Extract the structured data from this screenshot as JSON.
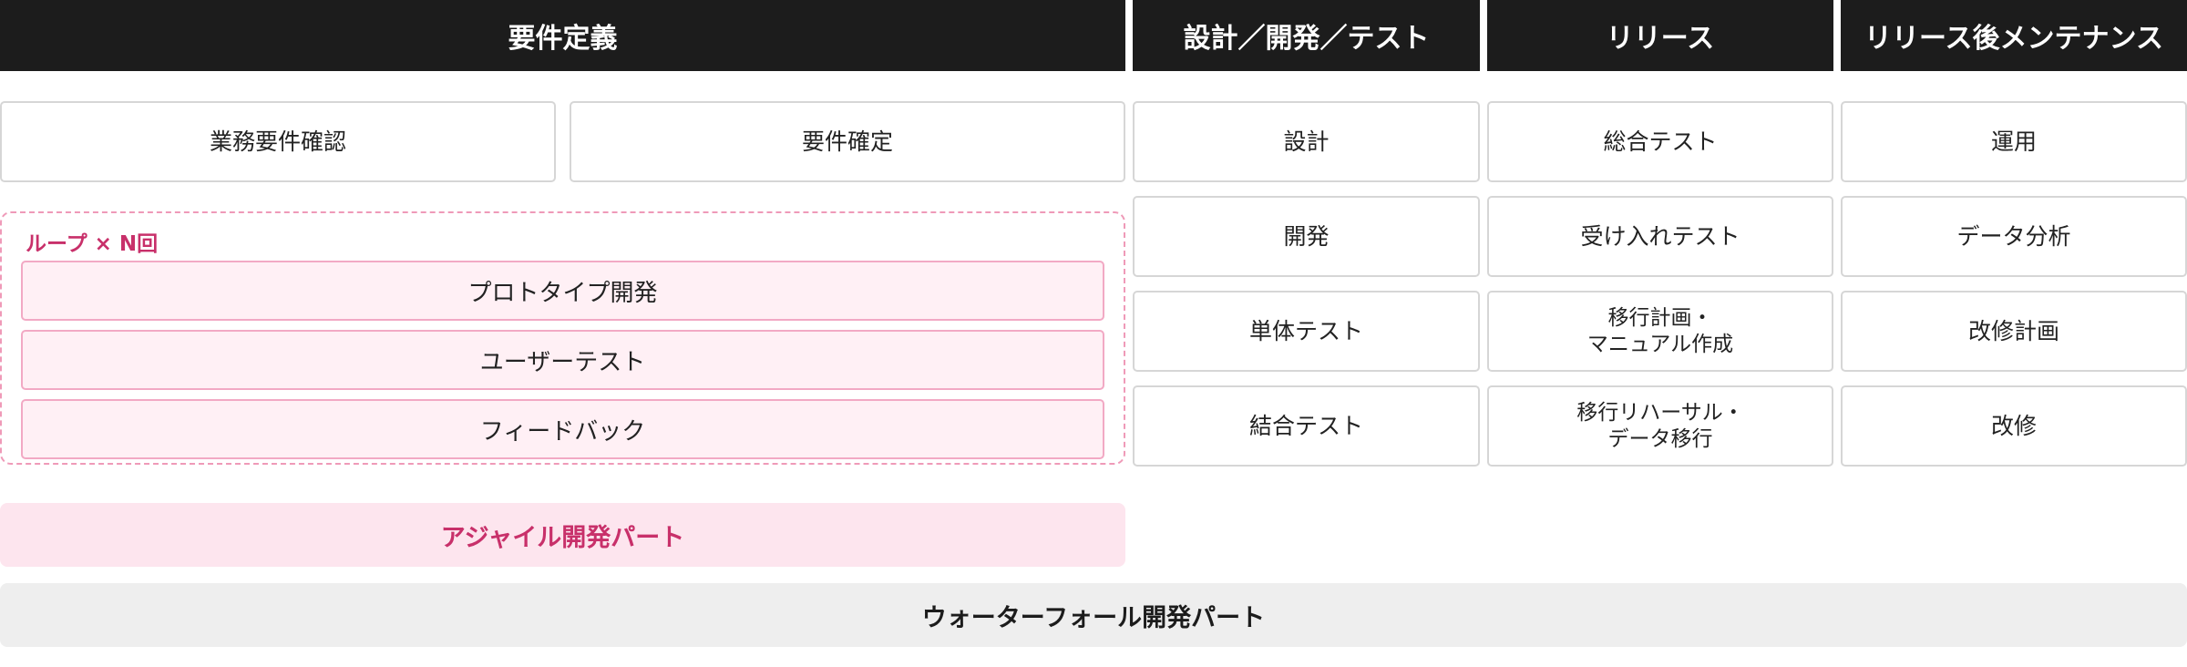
{
  "headers": {
    "requirements": "要件定義",
    "design_dev_test": "設計／開発／テスト",
    "release": "リリース",
    "post_release": "リリース後メンテナンス"
  },
  "requirements_boxes": {
    "business_check": "業務要件確認",
    "finalize": "要件確定"
  },
  "loop": {
    "label": "ループ × N回",
    "steps": [
      "プロトタイプ開発",
      "ユーザーテスト",
      "フィードバック"
    ]
  },
  "design_column": [
    "設計",
    "開発",
    "単体テスト",
    "結合テスト"
  ],
  "release_column": [
    "総合テスト",
    "受け入れテスト",
    "移行計画・\nマニュアル作成",
    "移行リハーサル・\nデータ移行"
  ],
  "maintenance_column": [
    "運用",
    "データ分析",
    "改修計画",
    "改修"
  ],
  "legend": {
    "agile": "アジャイル開発パート",
    "waterfall": "ウォーターフォール開発パート"
  },
  "colors": {
    "header_bg": "#1c1c1c",
    "agile_accent": "#c8306a",
    "agile_bg": "#fde5ee",
    "waterfall_bg": "#eeeeee"
  }
}
